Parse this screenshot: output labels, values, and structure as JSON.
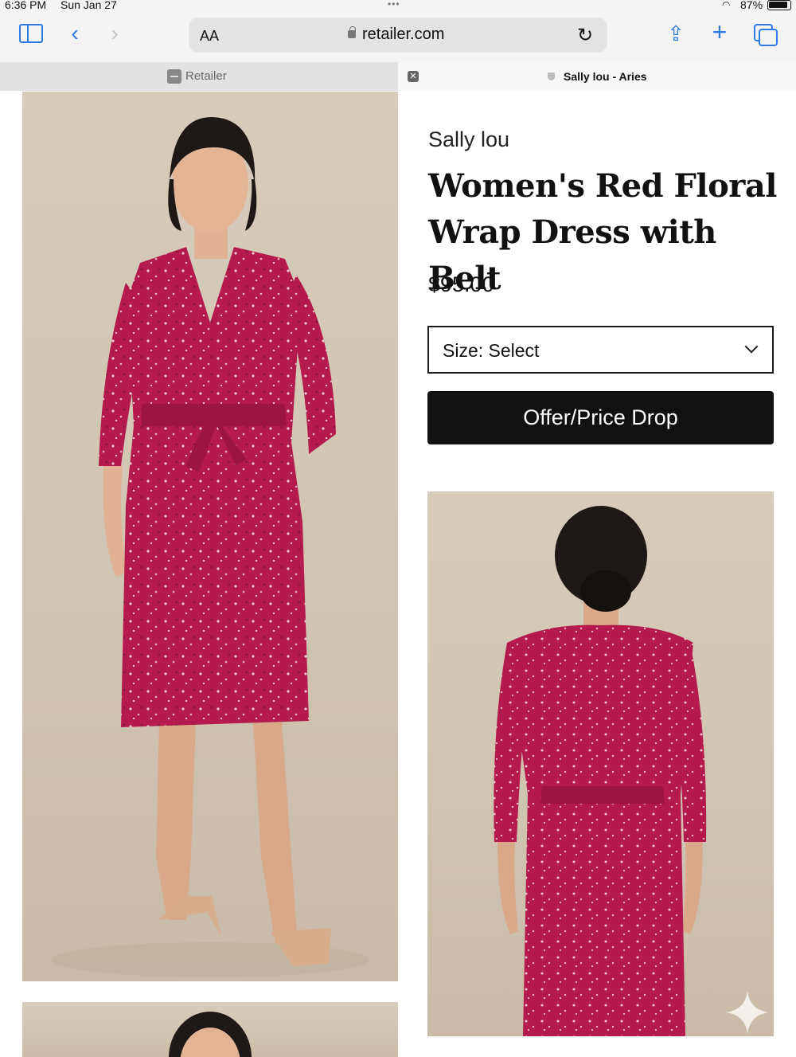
{
  "status_bar": {
    "time": "6:36 PM",
    "date": "Sun Jan 27",
    "battery": "87%"
  },
  "toolbar": {
    "text_size": "AA",
    "url": "retailer.com"
  },
  "tabs": [
    {
      "label": "Retailer",
      "active": false
    },
    {
      "label": "Sally lou - Aries",
      "active": true
    }
  ],
  "product": {
    "brand": "Sally lou",
    "title": "Women's Red Floral Wrap Dress with Belt",
    "price": "$95.00",
    "size_select_label": "Size: Select",
    "offer_button_label": "Offer/Price Drop"
  },
  "colors": {
    "dress": "#b51a4e",
    "background": "#d3c6b5",
    "button": "#111111",
    "accent": "#2f7ae5"
  }
}
